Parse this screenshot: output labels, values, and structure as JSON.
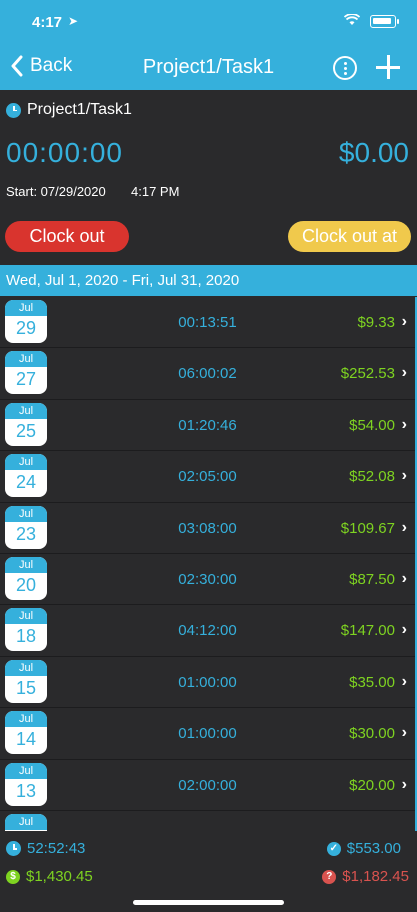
{
  "status_bar": {
    "time": "4:17",
    "location_glyph": "➤"
  },
  "nav": {
    "back_label": "Back",
    "title": "Project1/Task1"
  },
  "task": {
    "name": "Project1/Task1"
  },
  "timer": {
    "elapsed": "00:00:00",
    "amount": "$0.00"
  },
  "start": {
    "label": "Start: 07/29/2020",
    "time": "4:17 PM"
  },
  "buttons": {
    "clock_out": "Clock out",
    "clock_out_at": "Clock out at"
  },
  "range": {
    "label": "Wed, Jul 1, 2020 - Fri, Jul 31, 2020"
  },
  "entries": [
    {
      "month": "Jul",
      "day": "29",
      "duration": "00:13:51",
      "amount": "$9.33"
    },
    {
      "month": "Jul",
      "day": "27",
      "duration": "06:00:02",
      "amount": "$252.53"
    },
    {
      "month": "Jul",
      "day": "25",
      "duration": "01:20:46",
      "amount": "$54.00"
    },
    {
      "month": "Jul",
      "day": "24",
      "duration": "02:05:00",
      "amount": "$52.08"
    },
    {
      "month": "Jul",
      "day": "23",
      "duration": "03:08:00",
      "amount": "$109.67"
    },
    {
      "month": "Jul",
      "day": "20",
      "duration": "02:30:00",
      "amount": "$87.50"
    },
    {
      "month": "Jul",
      "day": "18",
      "duration": "04:12:00",
      "amount": "$147.00"
    },
    {
      "month": "Jul",
      "day": "15",
      "duration": "01:00:00",
      "amount": "$35.00"
    },
    {
      "month": "Jul",
      "day": "14",
      "duration": "01:00:00",
      "amount": "$30.00"
    },
    {
      "month": "Jul",
      "day": "13",
      "duration": "02:00:00",
      "amount": "$20.00"
    },
    {
      "month": "Jul",
      "day": "",
      "duration": "",
      "amount": ""
    }
  ],
  "footer": {
    "total_time": "52:52:43",
    "paid": "$553.00",
    "earned": "$1,430.45",
    "unpaid": "$1,182.45"
  },
  "colors": {
    "accent": "#35b0dc",
    "money_green": "#7ed321",
    "danger_red": "#d9342e",
    "warning_yellow": "#f0c94c",
    "background": "#2a2a2c"
  }
}
